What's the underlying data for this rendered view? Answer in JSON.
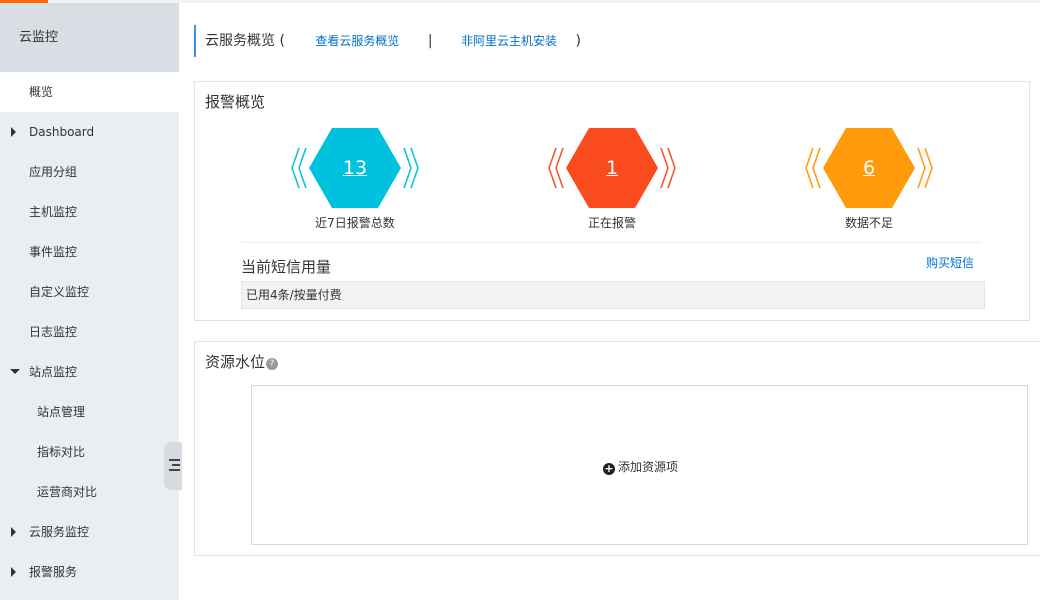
{
  "app": {
    "accent_color": "#ff6a00"
  },
  "sidebar": {
    "title": "云监控",
    "items": [
      {
        "label": "概览",
        "active": true,
        "expander": "none"
      },
      {
        "label": "Dashboard",
        "expander": "collapsed"
      },
      {
        "label": "应用分组",
        "expander": "none"
      },
      {
        "label": "主机监控",
        "expander": "none"
      },
      {
        "label": "事件监控",
        "expander": "none"
      },
      {
        "label": "自定义监控",
        "expander": "none"
      },
      {
        "label": "日志监控",
        "expander": "none"
      },
      {
        "label": "站点监控",
        "expander": "expanded"
      },
      {
        "label": "站点管理",
        "sub": true
      },
      {
        "label": "指标对比",
        "sub": true
      },
      {
        "label": "运营商对比",
        "sub": true
      },
      {
        "label": "云服务监控",
        "expander": "collapsed"
      },
      {
        "label": "报警服务",
        "expander": "collapsed"
      }
    ]
  },
  "header": {
    "title": "云服务概览",
    "paren_open": "(",
    "paren_close": ")",
    "separator": "|",
    "link_view": "查看云服务概览",
    "link_install": "非阿里云主机安装"
  },
  "alarm_overview": {
    "title": "报警概览",
    "stats": [
      {
        "value": "13",
        "label": "近7日报警总数",
        "color": "#00c1de"
      },
      {
        "value": "1",
        "label": "正在报警",
        "color": "#fa4b1e"
      },
      {
        "value": "6",
        "label": "数据不足",
        "color": "#ff9a0a"
      }
    ],
    "sms": {
      "title": "当前短信用量",
      "buy_label": "购买短信",
      "usage": "已用4条/按量付费"
    }
  },
  "resource": {
    "title": "资源水位",
    "help_icon": "?",
    "add_label": "添加资源项",
    "add_icon": "+"
  }
}
